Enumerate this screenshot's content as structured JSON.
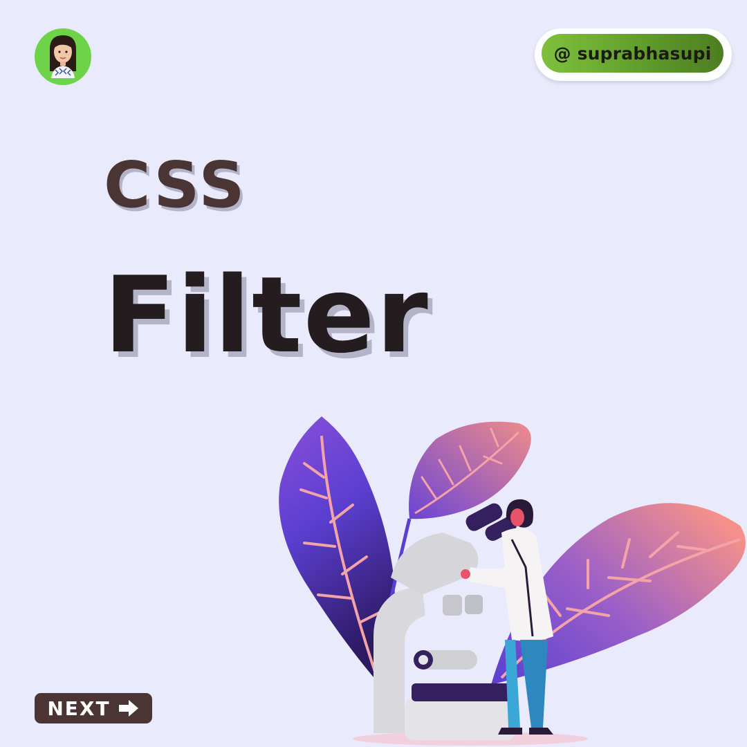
{
  "header": {
    "handle": "@ suprabhasupi"
  },
  "title": {
    "line1": "CSS",
    "line2": "Filter"
  },
  "footer": {
    "next_label": "NEXT"
  },
  "icons": {
    "avatar": "avatar-portrait",
    "next": "arrow-right-icon",
    "illustration": "scientist-microscope-illustration"
  },
  "colors": {
    "background": "#e9ebfd",
    "accent_green": "#6fd34a",
    "title_dark": "#241c1e",
    "button_brown": "#4a3434"
  }
}
